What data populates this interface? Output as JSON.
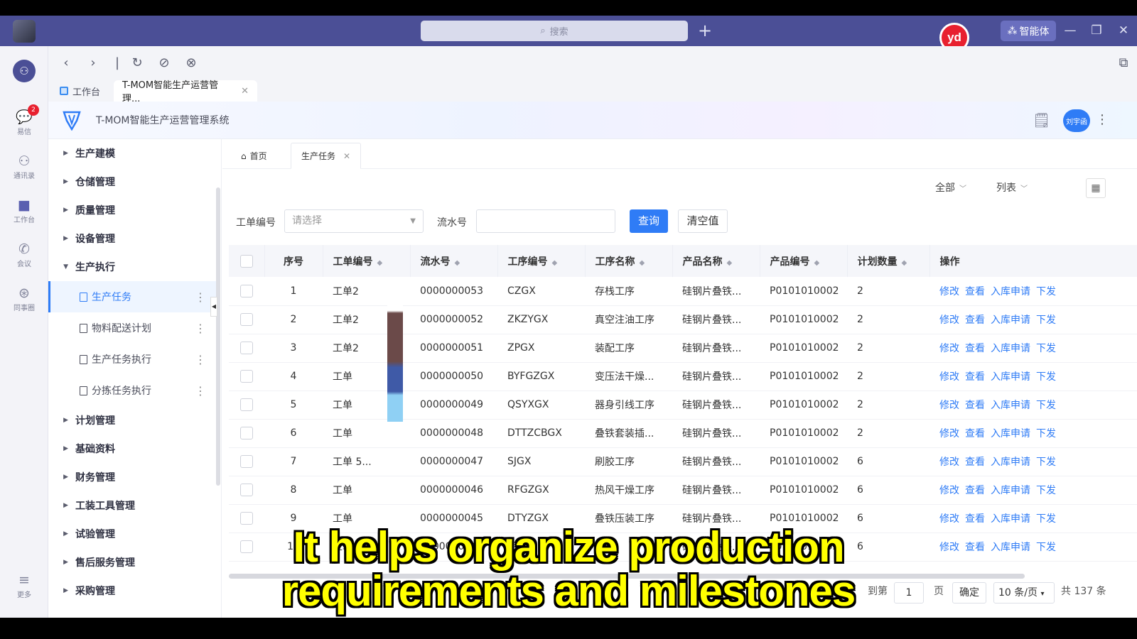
{
  "titlebar": {
    "search_placeholder": "搜索",
    "ai_label": "智能体",
    "yd_badge": "yd"
  },
  "rail": {
    "items": [
      {
        "label": "易信",
        "badge": "2"
      },
      {
        "label": "通讯录"
      },
      {
        "label": "工作台"
      },
      {
        "label": "会议"
      },
      {
        "label": "同事圈"
      },
      {
        "label": "更多"
      }
    ]
  },
  "browser_tabs": [
    {
      "label": "工作台"
    },
    {
      "label": "T-MOM智能生产运营管理..."
    }
  ],
  "app": {
    "title": "T-MOM智能生产运营管理系统",
    "user": "刘宇函"
  },
  "menu": {
    "groups_top": [
      "生产建模",
      "仓储管理",
      "质量管理",
      "设备管理"
    ],
    "expanded": "生产执行",
    "sub_items": [
      "生产任务",
      "物料配送计划",
      "生产任务执行",
      "分拣任务执行"
    ],
    "groups_bottom": [
      "计划管理",
      "基础资料",
      "财务管理",
      "工装工具管理",
      "试验管理",
      "售后服务管理",
      "采购管理"
    ]
  },
  "content_tabs": {
    "home": "首页",
    "active": "生产任务"
  },
  "view": {
    "scope": "全部",
    "mode": "列表"
  },
  "filters": {
    "order_label": "工单编号",
    "order_placeholder": "请选择",
    "serial_label": "流水号",
    "query_button": "查询",
    "reset_button": "清空值"
  },
  "table": {
    "headers": [
      "序号",
      "工单编号",
      "流水号",
      "工序编号",
      "工序名称",
      "产品名称",
      "产品编号",
      "计划数量",
      "操作"
    ],
    "rows": [
      {
        "no": "1",
        "order": "工单2",
        "serial": "0000000053",
        "proc_code": "CZGX",
        "proc_name": "存栈工序",
        "product": "硅钢片叠铁...",
        "product_code": "P0101010002",
        "qty": "2"
      },
      {
        "no": "2",
        "order": "工单2",
        "serial": "0000000052",
        "proc_code": "ZKZYGX",
        "proc_name": "真空注油工序",
        "product": "硅钢片叠铁...",
        "product_code": "P0101010002",
        "qty": "2"
      },
      {
        "no": "3",
        "order": "工单2",
        "serial": "0000000051",
        "proc_code": "ZPGX",
        "proc_name": "装配工序",
        "product": "硅钢片叠铁...",
        "product_code": "P0101010002",
        "qty": "2"
      },
      {
        "no": "4",
        "order": "工单",
        "serial": "0000000050",
        "proc_code": "BYFGZGX",
        "proc_name": "变压法干燥...",
        "product": "硅钢片叠铁...",
        "product_code": "P0101010002",
        "qty": "2"
      },
      {
        "no": "5",
        "order": "工单",
        "serial": "0000000049",
        "proc_code": "QSYXGX",
        "proc_name": "器身引线工序",
        "product": "硅钢片叠铁...",
        "product_code": "P0101010002",
        "qty": "2"
      },
      {
        "no": "6",
        "order": "工单",
        "serial": "0000000048",
        "proc_code": "DTTZCBGX",
        "proc_name": "叠铁套装插...",
        "product": "硅钢片叠铁...",
        "product_code": "P0101010002",
        "qty": "2"
      },
      {
        "no": "7",
        "order": "工单 5...",
        "serial": "0000000047",
        "proc_code": "SJGX",
        "proc_name": "刷胶工序",
        "product": "硅钢片叠铁...",
        "product_code": "P0101010002",
        "qty": "6"
      },
      {
        "no": "8",
        "order": "工单",
        "serial": "0000000046",
        "proc_code": "RFGZGX",
        "proc_name": "热风干燥工序",
        "product": "硅钢片叠铁...",
        "product_code": "P0101010002",
        "qty": "6"
      },
      {
        "no": "9",
        "order": "工单",
        "serial": "0000000045",
        "proc_code": "DTYZGX",
        "proc_name": "叠铁压装工序",
        "product": "硅钢片叠铁...",
        "product_code": "P0101010002",
        "qty": "6"
      },
      {
        "no": "10",
        "order": "工单",
        "serial": "0000000044",
        "proc_code": "",
        "proc_name": "",
        "product": "硅钢片叠铁...",
        "product_code": "P0101010002",
        "qty": "6"
      }
    ],
    "actions": [
      "修改",
      "查看",
      "入库申请",
      "下发"
    ]
  },
  "pager": {
    "goto_label": "到第",
    "page_value": "1",
    "page_unit": "页",
    "confirm": "确定",
    "page_size": "10 条/页",
    "total": "共 137 条"
  },
  "caption": {
    "line1": "It helps organize production",
    "line2": "requirements and milestones"
  },
  "colors": {
    "titlebar": "#4b4f96",
    "accent": "#2f7cf6",
    "caption": "#ffff00"
  }
}
